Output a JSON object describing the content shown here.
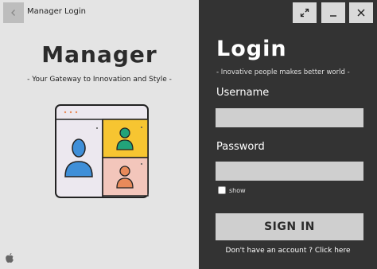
{
  "window": {
    "title": "Manager Login",
    "back_icon": "chevron-left-icon",
    "controls": [
      "expand-icon",
      "minimize-icon",
      "close-icon"
    ]
  },
  "branding": {
    "name": "Manager",
    "tagline": "- Your Gateway to Innovation and Style -",
    "illustration": "video-conference-illustration",
    "os_icon": "apple-icon"
  },
  "login": {
    "title": "Login",
    "subtitle": "- Inovative people makes better world -",
    "username_label": "Username",
    "username_value": "",
    "password_label": "Password",
    "password_value": "",
    "show_label": "show",
    "show_checked": false,
    "signin_label": "SIGN IN",
    "signup_text": "Don't have an account ? Click here"
  },
  "colors": {
    "left_bg": "#e4e4e4",
    "right_bg": "#333333",
    "field_bg": "#cfcfcf",
    "accent_yellow": "#f7c531",
    "accent_pink": "#f3c6bb",
    "accent_blue": "#3f8fd8",
    "accent_green": "#22a37a",
    "accent_orange": "#e88a5a"
  }
}
